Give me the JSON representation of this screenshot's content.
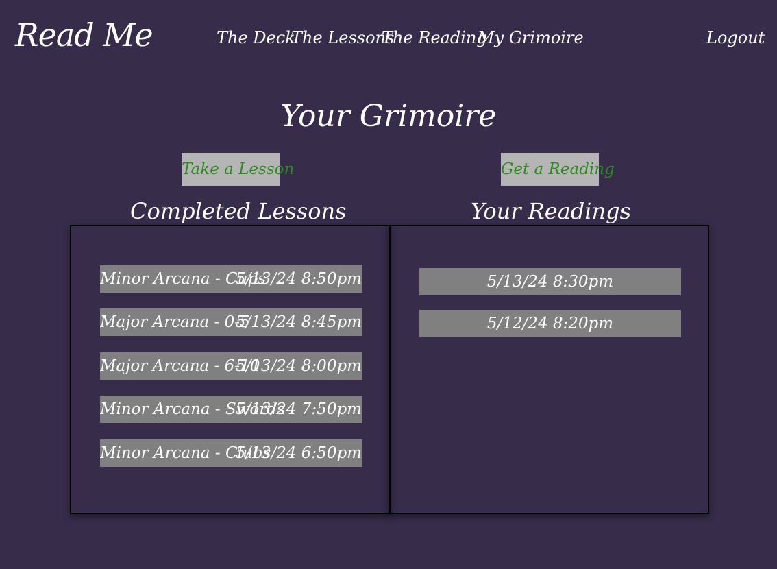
{
  "header": {
    "logo": "Read Me",
    "nav": [
      "The Deck",
      "The Lessons",
      "The Reading",
      "My Grimoire"
    ],
    "logout": "Logout"
  },
  "main": {
    "title": "Your Grimoire",
    "take_lesson_label": "Take a Lesson",
    "get_reading_label": "Get a Reading",
    "lessons_title": "Completed Lessons",
    "readings_title": "Your Readings",
    "lessons": [
      {
        "name": "Minor Arcana - Cups",
        "time": "5/13/24 8:50pm"
      },
      {
        "name": "Major Arcana - 0-5",
        "time": "5/13/24 8:45pm"
      },
      {
        "name": "Major Arcana - 6-10",
        "time": "5/13/24 8:00pm"
      },
      {
        "name": "Minor Arcana - Swords",
        "time": "5/13/24 7:50pm"
      },
      {
        "name": "Minor Arcana - Clubs",
        "time": "5/13/24 6:50pm"
      }
    ],
    "readings": [
      "5/13/24 8:30pm",
      "5/12/24 8:20pm"
    ]
  },
  "colors": {
    "background": "#382c4b",
    "row_background": "#808080",
    "button_background": "#b5b5b5",
    "button_text": "#2e8b1f"
  }
}
